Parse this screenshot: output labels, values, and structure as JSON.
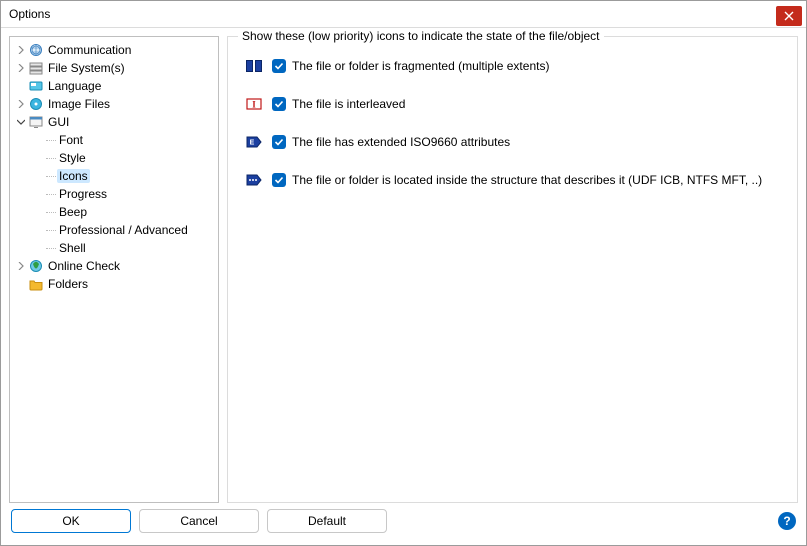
{
  "window": {
    "title": "Options"
  },
  "tree": {
    "communication": "Communication",
    "filesystems": "File System(s)",
    "language": "Language",
    "imagefiles": "Image Files",
    "gui": "GUI",
    "gui_children": {
      "font": "Font",
      "style": "Style",
      "icons": "Icons",
      "progress": "Progress",
      "beep": "Beep",
      "profadv": "Professional / Advanced",
      "shell": "Shell"
    },
    "onlinecheck": "Online Check",
    "folders": "Folders"
  },
  "group": {
    "legend": "Show these (low priority) icons to indicate the state of the file/object",
    "opts": {
      "fragmented": "The file or folder is fragmented (multiple extents)",
      "interleaved": "The file is interleaved",
      "iso9660": "The file has extended ISO9660 attributes",
      "inside": "The file or folder is located inside the structure that describes it (UDF ICB, NTFS MFT, ..)"
    }
  },
  "buttons": {
    "ok": "OK",
    "cancel": "Cancel",
    "default": "Default",
    "help": "?"
  }
}
